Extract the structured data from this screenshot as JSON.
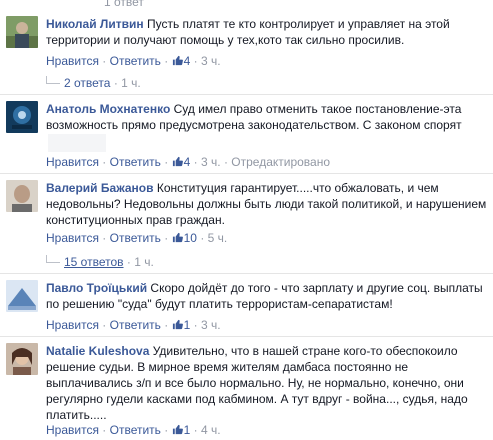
{
  "top_fragment": "1 ответ",
  "labels": {
    "reply": "Ответить",
    "like": "Нравится",
    "dot": "·"
  },
  "comments": [
    {
      "author": "Николай Литвин",
      "text": "Пусть платят те кто контролирует и управляет на этой территории и получают помощь у тех,кото так сильно просилив.",
      "likes": "4",
      "time": "3 ч.",
      "edited": "",
      "avatar_color": "#6f8a56"
    },
    {
      "author": "Анатоль Мохнатенко",
      "text": "Суд имел право отменить такое постановление-эта возможность прямо предусмотрена законодательством. С законом спорят",
      "likes": "4",
      "time": "3 ч.",
      "edited": "Отредактировано",
      "avatar_color": "#1b4e7a"
    },
    {
      "author": "Валерий Бажанов",
      "text": "Конституция гарантирует.....что обжаловать, и чем недовольны? Недовольны должны быть люди такой политикой, и нарушением конституционных прав граждан.",
      "likes": "10",
      "time": "5 ч.",
      "edited": "",
      "avatar_color": "#8d7a6a"
    },
    {
      "author": "Павло Троїцький",
      "text": "Скоро дойдёт до того - что зарплату и другие соц. выплаты по решению \"суда\" будут платить террористам-сепаратистам!",
      "likes": "1",
      "time": "3 ч.",
      "edited": "",
      "avatar_color": "#5a84b8"
    },
    {
      "author": "Natalie Kuleshova",
      "text": "Удивительно, что в нашей стране кого-то обеспокоило решение судьи. В мирное время жителям дамбаса постоянно не выплачивались з/п и все было нормально. Ну, не нормально, конечно, они регулярно гудели касками под кабмином. А тут вдруг - война..., судья, надо платить.....",
      "likes": "1",
      "time": "4 ч.",
      "edited": "",
      "avatar_color": "#7a5a4a"
    }
  ],
  "reply_threads": [
    {
      "label": "2 ответа",
      "time": "1 ч."
    },
    {
      "label": "15 ответов",
      "time": "1 ч."
    }
  ],
  "colors": {
    "link": "#3b5998",
    "meta": "#9197a3",
    "text": "#141823"
  }
}
